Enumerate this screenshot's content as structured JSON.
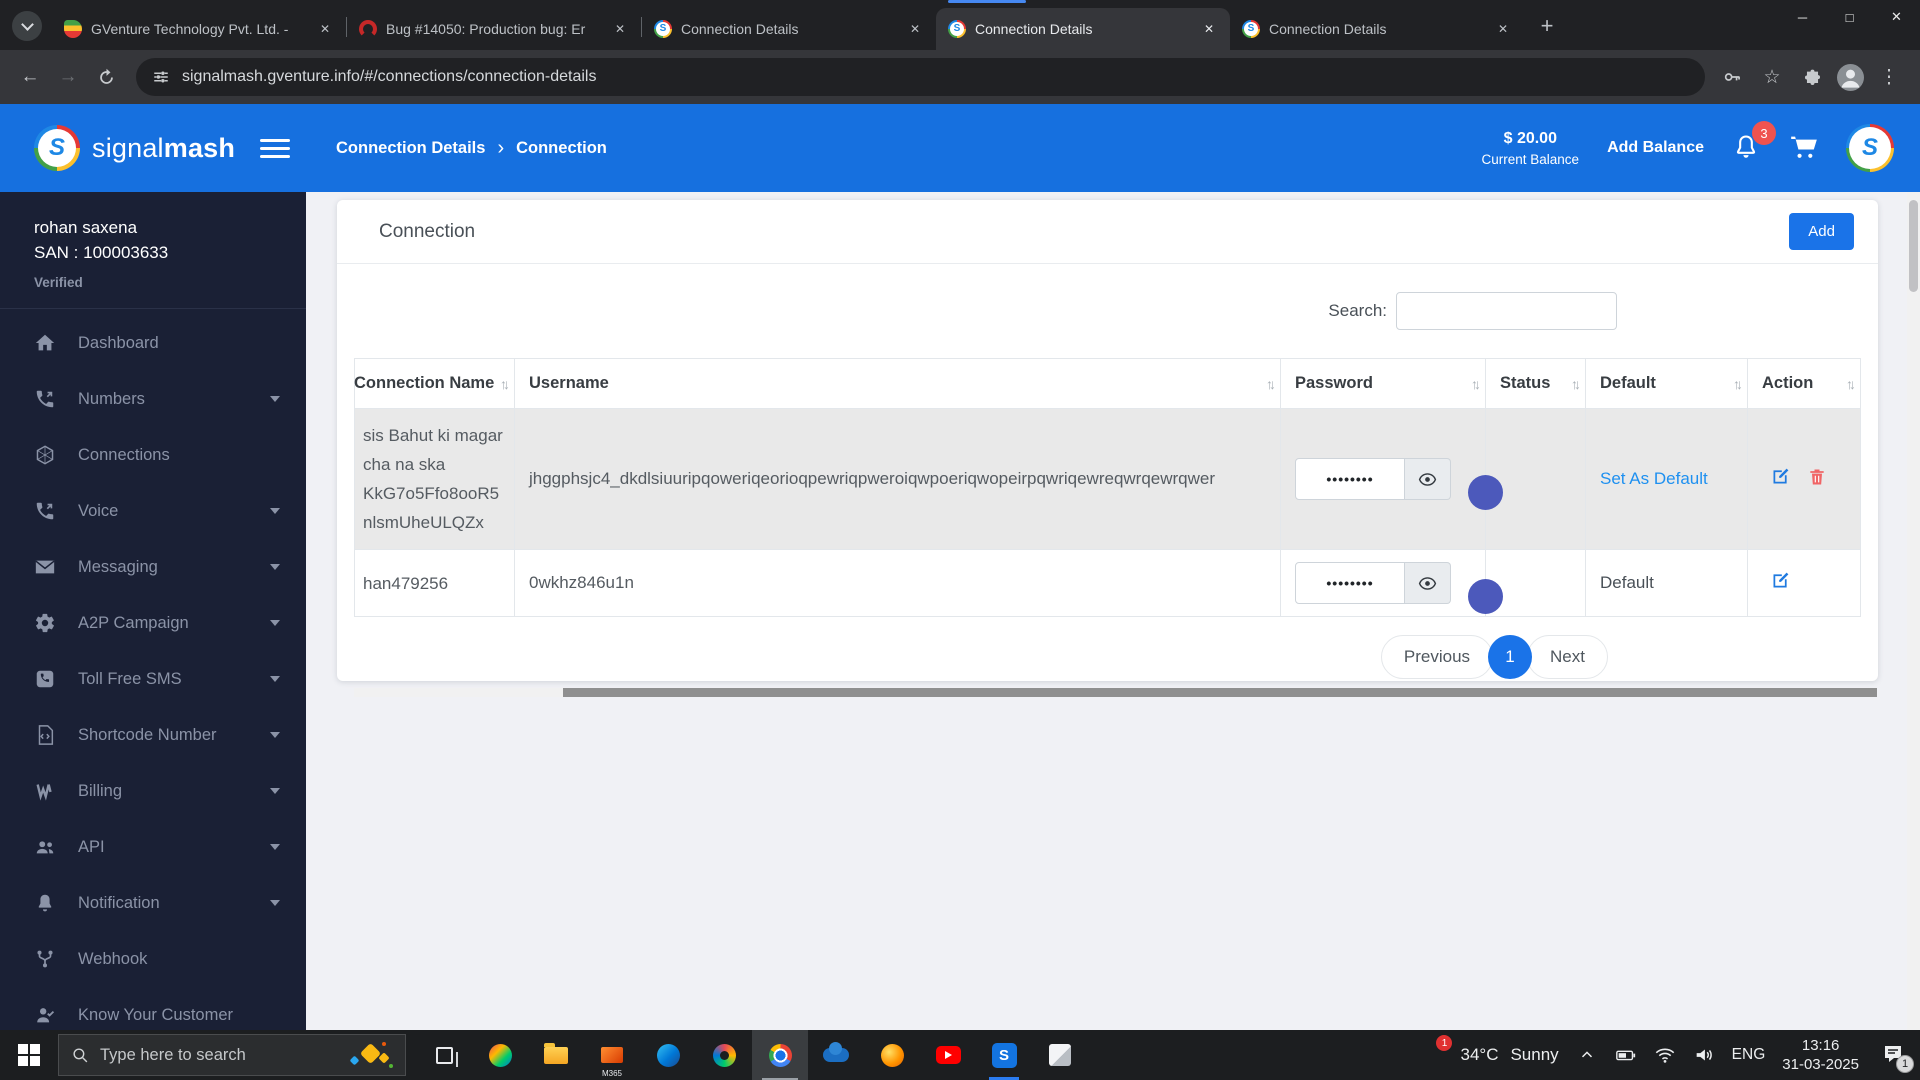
{
  "brand": {
    "name_light": "signal",
    "name_bold": "mash",
    "letter": "S"
  },
  "browser": {
    "tabs": [
      {
        "title": "GVenture Technology Pvt. Ltd. -",
        "favicon": "gventure"
      },
      {
        "title": "Bug #14050: Production bug: Er",
        "favicon": "redmine"
      },
      {
        "title": "Connection Details",
        "favicon": "signalmash"
      },
      {
        "title": "Connection Details",
        "favicon": "signalmash"
      },
      {
        "title": "Connection Details",
        "favicon": "signalmash"
      }
    ],
    "url": "signalmash.gventure.info/#/connections/connection-details"
  },
  "glyphs": {
    "close": "✕",
    "plus": "+",
    "back": "←",
    "forward": "→",
    "minimize": "─",
    "maximize": "□",
    "star": "☆",
    "kebab": "⋮",
    "sort": "↑↓",
    "crumb_sep": "›"
  },
  "header": {
    "breadcrumb1": "Connection Details",
    "breadcrumb2": "Connection",
    "balance_amount": "$ 20.00",
    "balance_label": "Current Balance",
    "add_balance": "Add Balance",
    "notification_count": "3"
  },
  "sidebar": {
    "user_name": "rohan saxena",
    "user_san": "SAN : 100003633",
    "user_status": "Verified",
    "items": [
      {
        "label": "Dashboard",
        "icon": "home"
      },
      {
        "label": "Numbers",
        "icon": "phone-volume"
      },
      {
        "label": "Connections",
        "icon": "hexagon"
      },
      {
        "label": "Voice",
        "icon": "phone-volume"
      },
      {
        "label": "Messaging",
        "icon": "envelope"
      },
      {
        "label": "A2P Campaign",
        "icon": "gear"
      },
      {
        "label": "Toll Free SMS",
        "icon": "phone-square"
      },
      {
        "label": "Shortcode Number",
        "icon": "file-code"
      },
      {
        "label": "Billing",
        "icon": "money-wave"
      },
      {
        "label": "API",
        "icon": "users"
      },
      {
        "label": "Notification",
        "icon": "bell"
      },
      {
        "label": "Webhook",
        "icon": "code-branch"
      },
      {
        "label": "Know Your Customer",
        "icon": "user-check"
      }
    ]
  },
  "main": {
    "card_title": "Connection",
    "add_button": "Add",
    "search_label": "Search:",
    "columns": [
      "Connection Name",
      "Username",
      "Password",
      "Status",
      "Default",
      "Action"
    ],
    "rows": [
      {
        "name_lines": [
          "sis Bahut ki magar",
          "cha na ska",
          "KkG7o5Ffo8ooR5",
          "nlsmUheULQZx"
        ],
        "username": "jhggphsjc4_dkdlsiuuripqoweriqeorioqpewriqpweroiqwpoeriqwopeirpqwriqewreqwrqewrqwer",
        "password_mask": "••••••••",
        "status": "on",
        "default_label": "Set As Default"
      },
      {
        "name_lines": [
          "han479256"
        ],
        "username": "0wkhz846u1n",
        "password_mask": "••••••••",
        "status": "on",
        "default_label": "Default"
      }
    ],
    "pagination_previous": "Previous",
    "pagination_current": "1",
    "pagination_next": "Next"
  },
  "taskbar": {
    "search_placeholder": "Type here to search",
    "m365_label": "M365",
    "weather_temp": "34°C",
    "weather_desc": "Sunny",
    "weather_badge": "1",
    "language": "ENG",
    "time": "13:16",
    "date": "31-03-2025",
    "notification_badge": "1"
  },
  "colors": {
    "header_blue": "#1670df",
    "sidebar_navy": "#1a2035",
    "row_gray": "#e9e9e9",
    "toggle_on": "#4c59bb",
    "link_blue": "#1e90f0",
    "danger_red": "#f06566"
  }
}
